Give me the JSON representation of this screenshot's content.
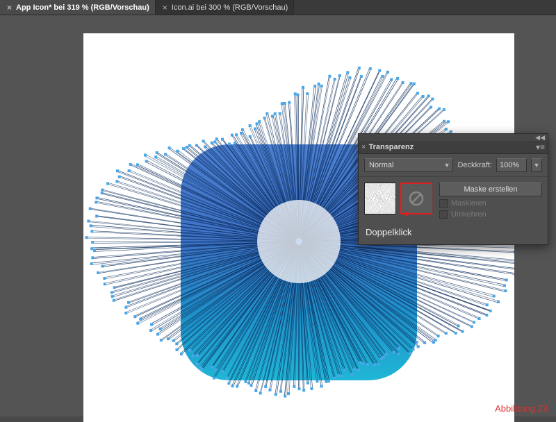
{
  "tabs": [
    {
      "label": "App Icon* bei 319 % (RGB/Vorschau)",
      "active": true
    },
    {
      "label": "Icon.ai bei 300 % (RGB/Vorschau)",
      "active": false
    }
  ],
  "panel": {
    "title": "Transparenz",
    "blend_mode": "Normal",
    "opacity_label": "Deckkraft:",
    "opacity_value": "100%",
    "create_mask": "Maske erstellen",
    "mask_chk": "Maskieren",
    "invert_chk": "Umkehren",
    "caption": "Doppelklick"
  },
  "figure_label": "Abbildung  23",
  "colors": {
    "stroke": "#0a2b5a",
    "anchor": "#4aa6e6"
  }
}
